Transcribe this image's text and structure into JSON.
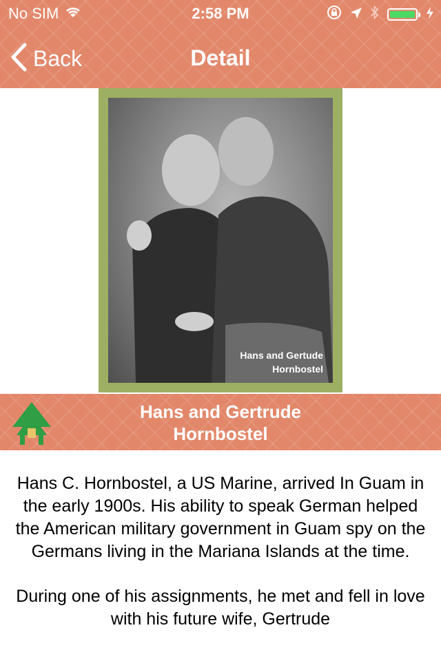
{
  "status_bar": {
    "carrier": "No SIM",
    "time": "2:58 PM"
  },
  "nav": {
    "back_label": "Back",
    "title": "Detail"
  },
  "photo": {
    "caption_line1": "Hans and Gertude",
    "caption_line2": "Hornbostel"
  },
  "band": {
    "title_line1": "Hans and Gertrude",
    "title_line2": "Hornbostel"
  },
  "body": {
    "paragraph1": "Hans C. Hornbostel, a US Marine, arrived In Guam in the early 1900s. His ability to speak German helped the American military government in Guam spy on the Germans living in the Mariana Islands at the time.",
    "paragraph2": "During one of his assignments, he met and fell in love with his future wife, Gertrude"
  },
  "colors": {
    "header": "#e2876a",
    "photo_frame": "#9caf62",
    "battery": "#4cd964",
    "house_roof": "#2f9e44",
    "house_door": "#e9c46a"
  },
  "icons": [
    "wifi-icon",
    "orientation-lock-icon",
    "location-arrow-icon",
    "bluetooth-icon",
    "battery-icon",
    "charging-bolt-icon",
    "back-chevron-icon",
    "latte-house-icon"
  ]
}
